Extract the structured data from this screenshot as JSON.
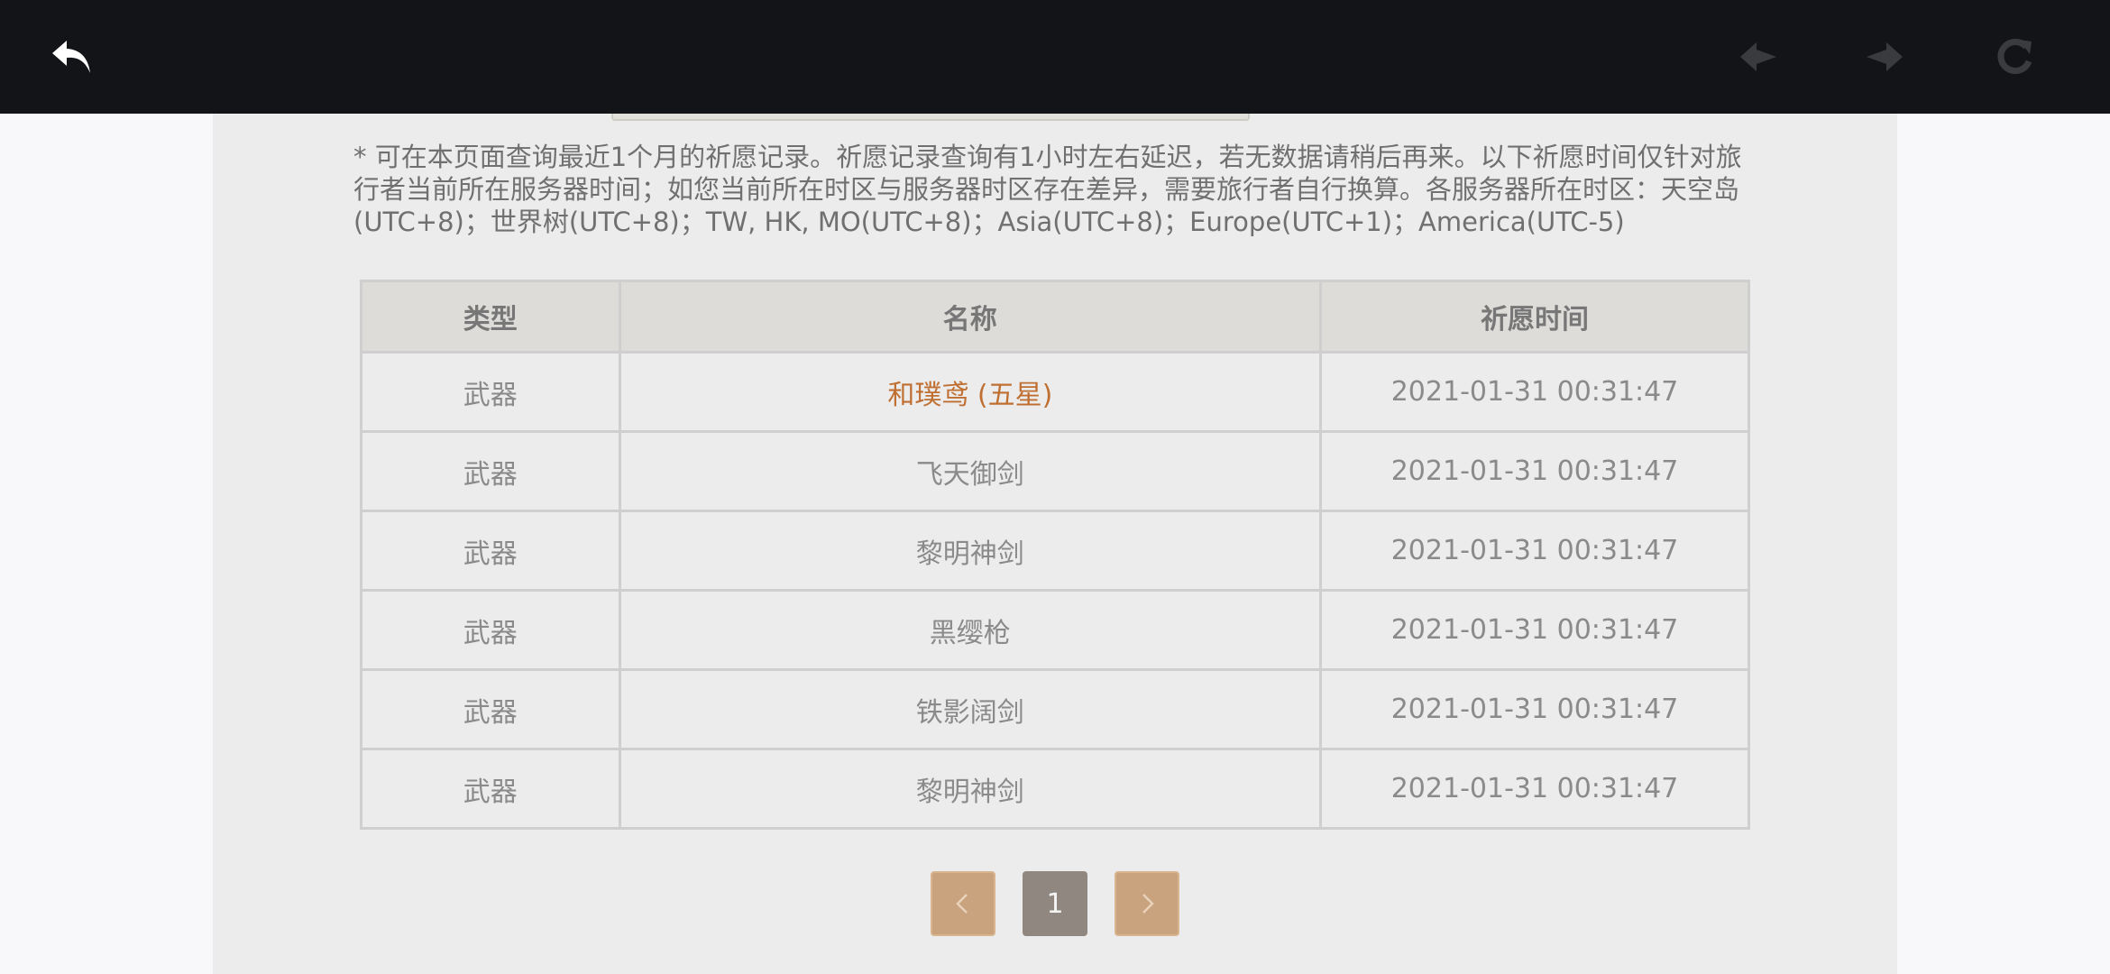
{
  "topbar": {
    "icons": [
      "back-arrow-icon",
      "previous-icon",
      "next-icon",
      "refresh-icon"
    ],
    "colors": {
      "background": "#131417",
      "active_icon": "#ffffff",
      "inactive_icon": "#3a3b3e"
    }
  },
  "notice": {
    "text": "* 可在本页面查询最近1个月的祈愿记录。祈愿记录查询有1小时左右延迟，若无数据请稍后再来。以下祈愿时间仅针对旅行者当前所在服务器时间；如您当前所在时区与服务器时区存在差异，需要旅行者自行换算。各服务器所在时区：天空岛(UTC+8)；世界树(UTC+8)；TW, HK, MO(UTC+8)；Asia(UTC+8)；Europe(UTC+1)；America(UTC-5)"
  },
  "table": {
    "headers": {
      "type": "类型",
      "name": "名称",
      "time": "祈愿时间"
    },
    "rows": [
      {
        "type": "武器",
        "name": "和璞鸢 (五星)",
        "time": "2021-01-31 00:31:47",
        "highlight": true
      },
      {
        "type": "武器",
        "name": "飞天御剑",
        "time": "2021-01-31 00:31:47",
        "highlight": false
      },
      {
        "type": "武器",
        "name": "黎明神剑",
        "time": "2021-01-31 00:31:47",
        "highlight": false
      },
      {
        "type": "武器",
        "name": "黑缨枪",
        "time": "2021-01-31 00:31:47",
        "highlight": false
      },
      {
        "type": "武器",
        "name": "铁影阔剑",
        "time": "2021-01-31 00:31:47",
        "highlight": false
      },
      {
        "type": "武器",
        "name": "黎明神剑",
        "time": "2021-01-31 00:31:47",
        "highlight": false
      }
    ],
    "colors": {
      "five_star": "#c06f32",
      "text": "#8a8a8a",
      "header_bg": "#dedcd8"
    }
  },
  "pagination": {
    "current_page": "1",
    "icons": [
      "chevron-left-icon",
      "chevron-right-icon"
    ],
    "colors": {
      "arrow_bg": "#c9a37e",
      "page_bg": "#908880"
    }
  }
}
